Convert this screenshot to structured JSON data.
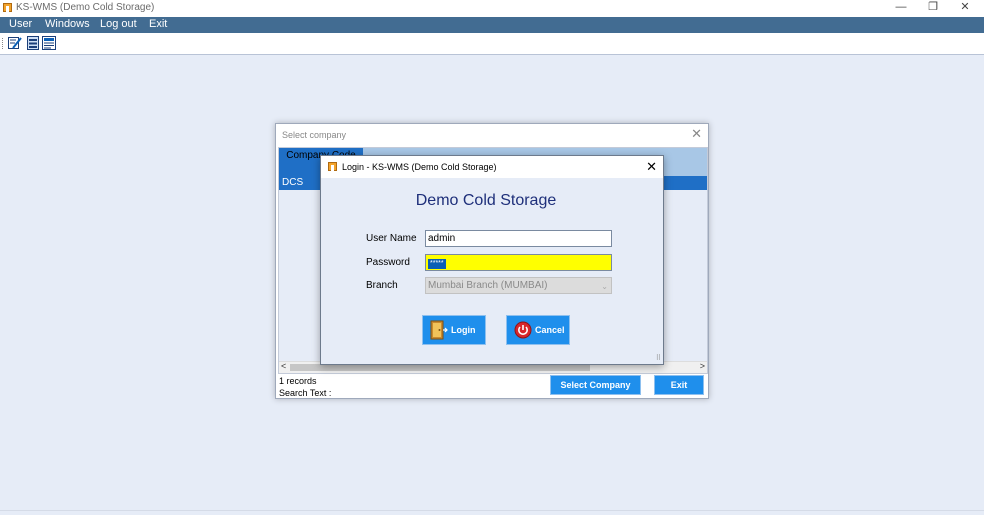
{
  "window": {
    "title": "KS-WMS (Demo Cold Storage)",
    "controls": {
      "minimize": "—",
      "restore": "❐",
      "close": "✕"
    }
  },
  "menu": [
    {
      "label": "User"
    },
    {
      "label": "Windows"
    },
    {
      "label": "Log out"
    },
    {
      "label": "Exit"
    }
  ],
  "toolbar": {
    "icons": [
      "edit-icon",
      "list-icon",
      "document-icon"
    ]
  },
  "select_company": {
    "title": "Select company",
    "close": "✕",
    "column_header": "Company Code",
    "rows": [
      {
        "code": "DCS"
      }
    ],
    "scroll_left": "<",
    "scroll_right": ">",
    "records": "1 records",
    "search_text": "Search Text :",
    "select_button": "Select Company",
    "exit_button": "Exit"
  },
  "login": {
    "title": "Login - KS-WMS (Demo Cold Storage)",
    "close": "✕",
    "heading": "Demo Cold Storage",
    "username_label": "User Name",
    "username_value": "admin",
    "password_label": "Password",
    "password_value": "*****",
    "branch_label": "Branch",
    "branch_value": "Mumbai Branch  (MUMBAI)",
    "branch_dropdown": "⌄",
    "login_button": "Login",
    "cancel_button": "Cancel",
    "resize_grip": "⠿"
  },
  "colors": {
    "menubar": "#426c92",
    "accent_blue": "#1f8fec",
    "selection": "#1f6fc6",
    "password_field": "#ffff00",
    "heading": "#1e2f7a"
  }
}
